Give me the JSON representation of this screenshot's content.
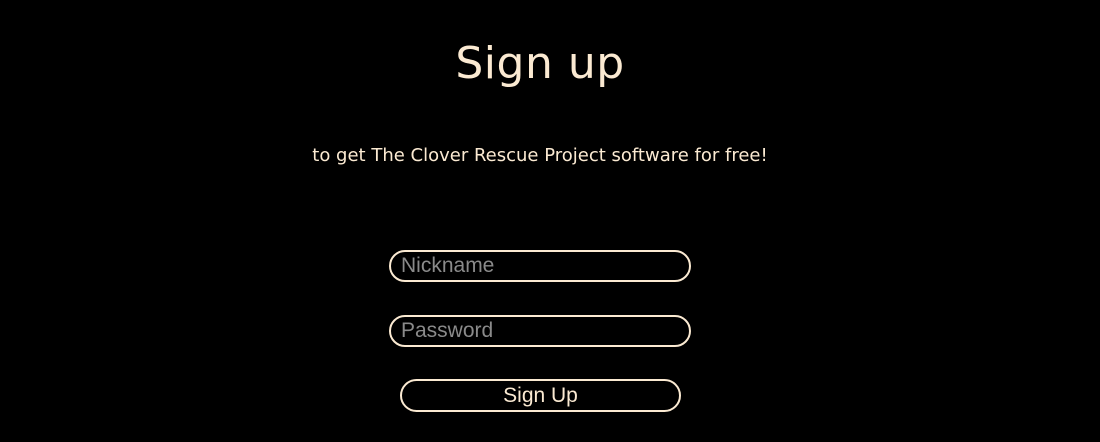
{
  "page": {
    "title": "Sign up",
    "subtitle": "to get The Clover Rescue Project software for free!"
  },
  "form": {
    "nickname": {
      "placeholder": "Nickname",
      "value": ""
    },
    "password": {
      "placeholder": "Password",
      "value": ""
    },
    "submit_label": "Sign Up"
  },
  "colors": {
    "background": "#000000",
    "text": "#fbead2",
    "placeholder": "#8a8a8a"
  }
}
